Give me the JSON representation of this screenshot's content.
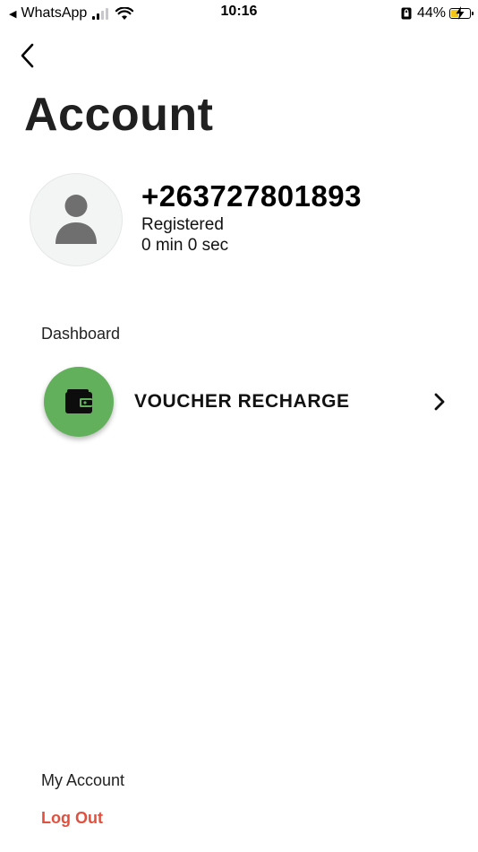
{
  "status_bar": {
    "back_app": "WhatsApp",
    "time": "10:16",
    "battery_percent": "44%",
    "battery_level": 0.44,
    "battery_color": "#f5c518"
  },
  "nav": {
    "back_icon": "chevron-left-icon",
    "title": "Account"
  },
  "profile": {
    "avatar_icon": "person-icon",
    "phone": "+263727801893",
    "status": "Registered",
    "duration": "0 min 0 sec"
  },
  "dashboard": {
    "label": "Dashboard",
    "items": [
      {
        "icon": "wallet-icon",
        "label": "VOUCHER RECHARGE",
        "icon_bg": "#62b05b",
        "trailing_icon": "chevron-right-icon"
      }
    ]
  },
  "account": {
    "label": "My Account",
    "logout_label": "Log Out",
    "logout_color": "#e0513f"
  }
}
